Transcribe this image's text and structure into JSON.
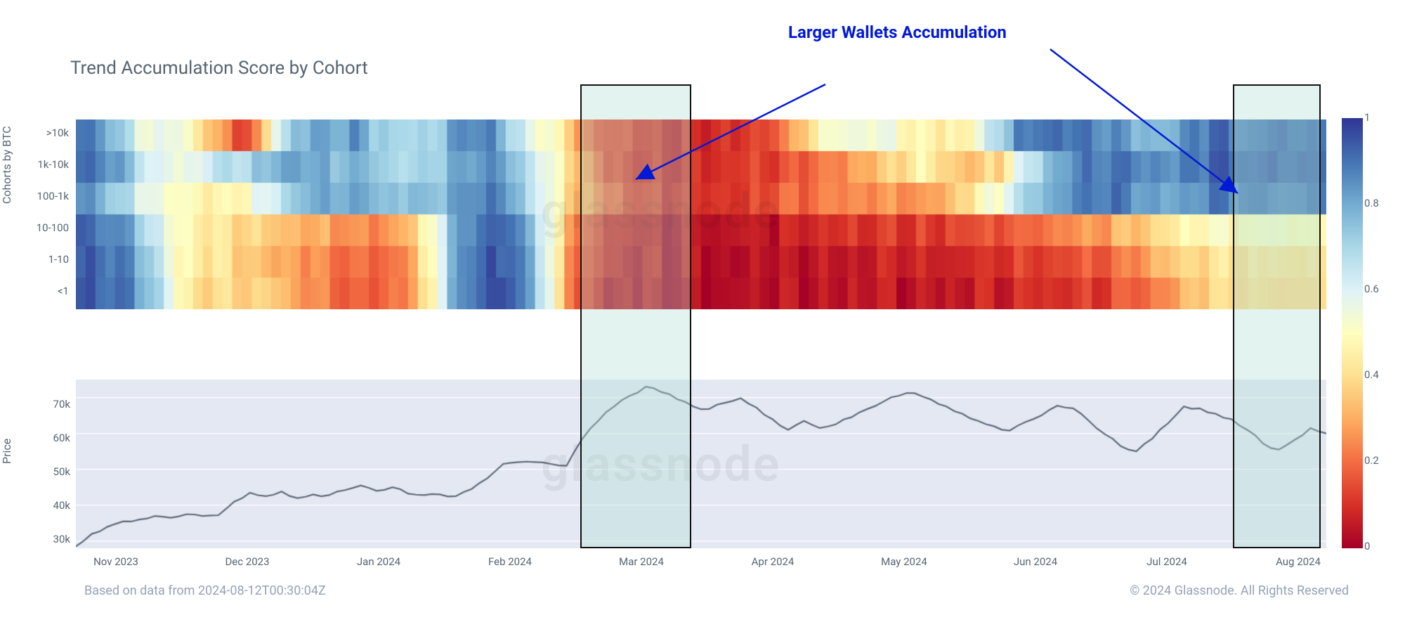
{
  "title": "Trend Accumulation Score by Cohort",
  "annotation_label": "Larger Wallets Accumulation",
  "y1_label": "Cohorts by BTC",
  "y2_label": "Price",
  "footer_left": "Based on data from 2024-08-12T00:30:04Z",
  "footer_right": "© 2024 Glassnode. All Rights Reserved",
  "watermark": "glassnode",
  "cohorts": [
    ">10k",
    "1k-10k",
    "100-1k",
    "10-100",
    "1-10",
    "<1"
  ],
  "price_ticks": [
    "30k",
    "40k",
    "50k",
    "60k",
    "70k"
  ],
  "x_ticks": [
    "Nov 2023",
    "Dec 2023",
    "Jan 2024",
    "Feb 2024",
    "Mar 2024",
    "Apr 2024",
    "May 2024",
    "Jun 2024",
    "Jul 2024",
    "Aug 2024"
  ],
  "colorbar_ticks": [
    "0",
    "0.2",
    "0.4",
    "0.6",
    "0.8",
    "1"
  ],
  "chart_data": {
    "type": "heatmap",
    "title": "Trend Accumulation Score by Cohort",
    "ylabel_top": "Cohorts by BTC",
    "ylabel_bottom": "Price",
    "x_categories_months": [
      "Nov 2023",
      "Dec 2023",
      "Jan 2024",
      "Feb 2024",
      "Mar 2024",
      "Apr 2024",
      "May 2024",
      "Jun 2024",
      "Jul 2024",
      "Aug 2024"
    ],
    "y_categories": [
      ">10k",
      "1k-10k",
      "100-1k",
      "10-100",
      "1-10",
      "<1"
    ],
    "colorscale": "RdYlBu",
    "zmin": 0,
    "zmax": 1,
    "columns_per_month": 12,
    "heatmap_anchors": {
      ">10k": [
        0.9,
        0.85,
        0.7,
        0.6,
        0.55,
        0.55,
        0.45,
        0.3,
        0.15,
        0.2,
        0.6,
        0.75,
        0.8,
        0.8,
        0.85,
        0.75,
        0.7,
        0.7,
        0.7,
        0.8,
        0.9,
        0.85,
        0.7,
        0.6,
        0.5,
        0.4,
        0.2,
        0.15,
        0.15,
        0.1,
        0.08,
        0.08,
        0.1,
        0.1,
        0.1,
        0.15,
        0.2,
        0.35,
        0.5,
        0.55,
        0.55,
        0.55,
        0.5,
        0.45,
        0.45,
        0.45,
        0.55,
        0.7,
        0.85,
        0.9,
        0.9,
        0.9,
        0.88,
        0.85,
        0.8,
        0.75,
        0.8,
        0.9,
        0.9,
        0.9
      ],
      "1k-10k": [
        0.9,
        0.88,
        0.8,
        0.68,
        0.58,
        0.55,
        0.6,
        0.65,
        0.7,
        0.72,
        0.78,
        0.82,
        0.8,
        0.78,
        0.78,
        0.75,
        0.7,
        0.7,
        0.72,
        0.78,
        0.85,
        0.85,
        0.78,
        0.65,
        0.55,
        0.4,
        0.25,
        0.15,
        0.1,
        0.08,
        0.08,
        0.08,
        0.1,
        0.1,
        0.12,
        0.15,
        0.15,
        0.18,
        0.2,
        0.25,
        0.3,
        0.35,
        0.4,
        0.45,
        0.4,
        0.35,
        0.35,
        0.4,
        0.55,
        0.7,
        0.8,
        0.85,
        0.9,
        0.9,
        0.88,
        0.85,
        0.85,
        0.9,
        0.92,
        0.92
      ],
      "100-1k": [
        0.85,
        0.8,
        0.7,
        0.62,
        0.55,
        0.5,
        0.48,
        0.45,
        0.48,
        0.55,
        0.65,
        0.75,
        0.8,
        0.8,
        0.8,
        0.78,
        0.76,
        0.75,
        0.76,
        0.8,
        0.86,
        0.88,
        0.82,
        0.68,
        0.55,
        0.4,
        0.28,
        0.2,
        0.15,
        0.12,
        0.1,
        0.1,
        0.1,
        0.12,
        0.12,
        0.15,
        0.18,
        0.2,
        0.22,
        0.25,
        0.25,
        0.25,
        0.25,
        0.25,
        0.3,
        0.38,
        0.45,
        0.55,
        0.65,
        0.75,
        0.82,
        0.86,
        0.88,
        0.88,
        0.85,
        0.8,
        0.8,
        0.85,
        0.88,
        0.88
      ],
      "10-100": [
        0.92,
        0.9,
        0.85,
        0.75,
        0.6,
        0.5,
        0.45,
        0.42,
        0.4,
        0.38,
        0.35,
        0.32,
        0.3,
        0.28,
        0.25,
        0.25,
        0.28,
        0.35,
        0.55,
        0.75,
        0.88,
        0.92,
        0.9,
        0.78,
        0.55,
        0.3,
        0.15,
        0.1,
        0.08,
        0.06,
        0.05,
        0.05,
        0.05,
        0.05,
        0.05,
        0.06,
        0.06,
        0.08,
        0.08,
        0.1,
        0.1,
        0.12,
        0.12,
        0.12,
        0.12,
        0.15,
        0.15,
        0.18,
        0.18,
        0.2,
        0.22,
        0.25,
        0.28,
        0.3,
        0.35,
        0.4,
        0.45,
        0.48,
        0.5,
        0.5
      ],
      "1-10": [
        0.94,
        0.92,
        0.88,
        0.8,
        0.65,
        0.5,
        0.45,
        0.42,
        0.38,
        0.35,
        0.3,
        0.28,
        0.25,
        0.22,
        0.2,
        0.2,
        0.22,
        0.3,
        0.52,
        0.75,
        0.9,
        0.95,
        0.92,
        0.8,
        0.55,
        0.28,
        0.12,
        0.08,
        0.06,
        0.05,
        0.04,
        0.04,
        0.04,
        0.04,
        0.04,
        0.04,
        0.05,
        0.05,
        0.05,
        0.06,
        0.06,
        0.07,
        0.07,
        0.08,
        0.08,
        0.08,
        0.1,
        0.1,
        0.12,
        0.12,
        0.15,
        0.15,
        0.18,
        0.2,
        0.25,
        0.3,
        0.35,
        0.4,
        0.42,
        0.42
      ],
      "<1": [
        0.95,
        0.93,
        0.9,
        0.82,
        0.68,
        0.5,
        0.4,
        0.4,
        0.4,
        0.38,
        0.35,
        0.3,
        0.25,
        0.2,
        0.18,
        0.18,
        0.2,
        0.28,
        0.5,
        0.75,
        0.92,
        0.96,
        0.94,
        0.82,
        0.55,
        0.25,
        0.1,
        0.06,
        0.05,
        0.04,
        0.03,
        0.03,
        0.03,
        0.03,
        0.03,
        0.03,
        0.04,
        0.04,
        0.04,
        0.04,
        0.05,
        0.05,
        0.05,
        0.06,
        0.06,
        0.06,
        0.08,
        0.08,
        0.08,
        0.1,
        0.1,
        0.12,
        0.12,
        0.15,
        0.18,
        0.22,
        0.28,
        0.35,
        0.4,
        0.4
      ]
    },
    "price_series": {
      "ylim": [
        28000,
        75000
      ],
      "values": [
        28500,
        32000,
        34000,
        35500,
        36000,
        37000,
        36500,
        37500,
        37000,
        37200,
        41000,
        43500,
        42500,
        43800,
        42000,
        43000,
        42800,
        44200,
        45500,
        44000,
        45000,
        43200,
        42800,
        43000,
        42500,
        44500,
        47500,
        51500,
        52000,
        52000,
        51500,
        51000,
        58500,
        63500,
        67500,
        70500,
        73000,
        71500,
        69500,
        67500,
        66800,
        68500,
        69800,
        67200,
        64000,
        61000,
        63500,
        61500,
        62500,
        64500,
        66800,
        68800,
        70500,
        71200,
        69500,
        67500,
        65500,
        63500,
        62000,
        60800,
        63200,
        65000,
        67700,
        67000,
        63500,
        59800,
        56500,
        55000,
        58500,
        62800,
        67500,
        67000,
        65500,
        64000,
        61000,
        57200,
        55500,
        58200,
        61500,
        60000
      ]
    },
    "highlight_windows": [
      {
        "start": "2024-02-18",
        "end": "2024-03-05"
      },
      {
        "start": "2024-07-24",
        "end": "2024-08-12"
      }
    ],
    "annotation": {
      "text": "Larger Wallets Accumulation",
      "targets": [
        "highlight0",
        "highlight1"
      ]
    }
  }
}
